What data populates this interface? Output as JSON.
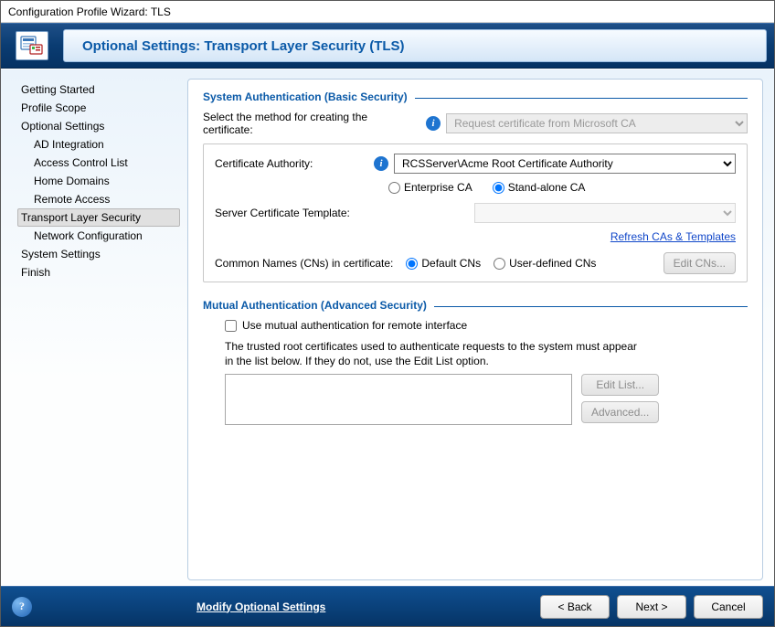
{
  "window": {
    "title": "Configuration Profile Wizard: TLS"
  },
  "header": {
    "title": "Optional Settings: Transport Layer Security (TLS)"
  },
  "nav": {
    "items": [
      {
        "label": "Getting Started",
        "level": 0
      },
      {
        "label": "Profile Scope",
        "level": 0
      },
      {
        "label": "Optional Settings",
        "level": 0
      },
      {
        "label": "AD Integration",
        "level": 1
      },
      {
        "label": "Access Control List",
        "level": 1
      },
      {
        "label": "Home Domains",
        "level": 1
      },
      {
        "label": "Remote Access",
        "level": 1
      },
      {
        "label": "Transport Layer Security",
        "level": 1,
        "selected": true
      },
      {
        "label": "Network Configuration",
        "level": 1
      },
      {
        "label": "System Settings",
        "level": 0
      },
      {
        "label": "Finish",
        "level": 0
      }
    ]
  },
  "system_auth": {
    "section_title": "System Authentication (Basic Security)",
    "method_label": "Select the method for creating the certificate:",
    "method_value": "Request certificate from Microsoft CA",
    "ca_label": "Certificate Authority:",
    "ca_value": "RCSServer\\Acme Root Certificate Authority",
    "ca_type": {
      "enterprise": "Enterprise CA",
      "standalone": "Stand-alone CA",
      "selected": "standalone"
    },
    "template_label": "Server Certificate Template:",
    "template_value": "",
    "refresh_link": "Refresh CAs & Templates",
    "cn_label": "Common Names (CNs) in certificate:",
    "cn_default": "Default CNs",
    "cn_user": "User-defined  CNs",
    "cn_selected": "default",
    "edit_cns_btn": "Edit CNs..."
  },
  "mutual_auth": {
    "section_title": "Mutual Authentication (Advanced Security)",
    "checkbox_label": "Use mutual authentication for remote interface",
    "checked": false,
    "desc": "The trusted root certificates used to authenticate requests to the system must appear in the list below. If they do not, use the Edit List option.",
    "edit_list_btn": "Edit List...",
    "advanced_btn": "Advanced..."
  },
  "footer": {
    "modify_link": "Modify Optional Settings",
    "back": "< Back",
    "next": "Next >",
    "cancel": "Cancel"
  }
}
